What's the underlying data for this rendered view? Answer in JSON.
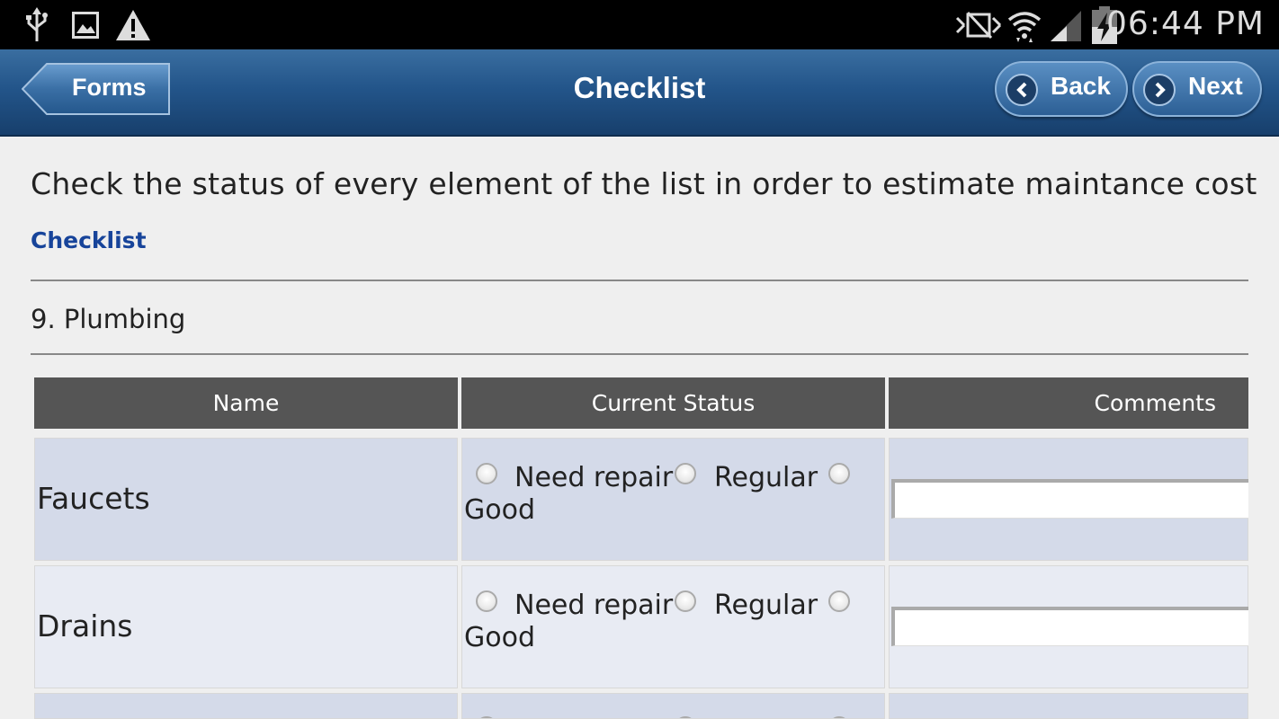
{
  "status_bar": {
    "time": "06:44 PM",
    "icons": [
      "usb-icon",
      "image-icon",
      "warning-icon",
      "mute-icon",
      "wifi-icon",
      "signal-icon",
      "battery-icon"
    ]
  },
  "header": {
    "title": "Checklist",
    "forms_label": "Forms",
    "back_label": "Back",
    "next_label": "Next"
  },
  "content": {
    "description": "Check the status of every element of the list in order to estimate maintance cost",
    "link": "Checklist",
    "section": "9. Plumbing"
  },
  "table": {
    "columns": [
      "Name",
      "Current Status",
      "Comments"
    ],
    "rows": [
      {
        "name": "Faucets",
        "options": [
          "Need repair",
          "Regular",
          "Good"
        ]
      },
      {
        "name": "Drains",
        "options": [
          "Need repair",
          "Regular",
          "Good"
        ]
      },
      {
        "name": "",
        "options": [
          "",
          "",
          ""
        ]
      }
    ]
  },
  "colors": {
    "header_bar": "#23558a",
    "table_header": "#555555",
    "row_dark": "#d4dae9",
    "row_light": "#e8ebf3",
    "link": "#17449a"
  }
}
